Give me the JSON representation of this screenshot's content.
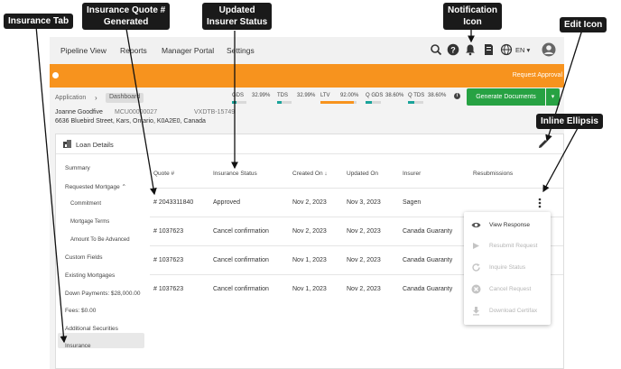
{
  "nav": {
    "items": [
      "Pipeline View",
      "Reports",
      "Manager Portal",
      "Settings"
    ],
    "language": "EN"
  },
  "banner": {
    "text": "Request Approval"
  },
  "header": {
    "breadcrumb_root": "Application",
    "breadcrumb_current": "Dashboard",
    "borrower": "Joanne Goodfive",
    "loan_id": "MCU00000027",
    "deal_id": "VXDTB-15749",
    "address": "6636 Bluebird Street, Kars, Ontario, K0A2E0, Canada",
    "ratios": [
      {
        "label": "GDS",
        "value": "32.99%",
        "fill": 0.33,
        "color": "#1aa39a"
      },
      {
        "label": "TDS",
        "value": "32.99%",
        "fill": 0.33,
        "color": "#1aa39a"
      },
      {
        "label": "LTV",
        "value": "92.00%",
        "fill": 0.92,
        "color": "#f7931e"
      },
      {
        "label": "Q GDS",
        "value": "38.60%",
        "fill": 0.39,
        "color": "#1aa39a"
      },
      {
        "label": "Q TDS",
        "value": "38.60%",
        "fill": 0.39,
        "color": "#1aa39a"
      }
    ],
    "generate_label": "Generate Documents"
  },
  "card": {
    "title": "Loan Details"
  },
  "side": {
    "items": [
      {
        "label": "Summary",
        "sub": false
      },
      {
        "label": "Requested Mortgage ⌃",
        "sub": false
      },
      {
        "label": "Commitment",
        "sub": true
      },
      {
        "label": "Mortgage Terms",
        "sub": true
      },
      {
        "label": "Amount To Be Advanced",
        "sub": true
      },
      {
        "label": "Custom Fields",
        "sub": false
      },
      {
        "label": "Existing Mortgages",
        "sub": false
      },
      {
        "label": "Down Payments: $28,000.00",
        "sub": false
      },
      {
        "label": "Fees: $0.00",
        "sub": false
      },
      {
        "label": "Additional Securities",
        "sub": false
      },
      {
        "label": "Insurance",
        "sub": false
      }
    ]
  },
  "table": {
    "headers": [
      "Quote #",
      "Insurance Status",
      "Created On ↓",
      "Updated On",
      "Insurer",
      "Resubmissions"
    ],
    "rows": [
      [
        "# 2043311840",
        "Approved",
        "Nov 2, 2023",
        "Nov 3, 2023",
        "Sagen"
      ],
      [
        "# 1037623",
        "Cancel confirmation",
        "Nov 2, 2023",
        "Nov 2, 2023",
        "Canada Guaranty"
      ],
      [
        "# 1037623",
        "Cancel confirmation",
        "Nov 1, 2023",
        "Nov 2, 2023",
        "Canada Guaranty"
      ],
      [
        "# 1037623",
        "Cancel confirmation",
        "Nov 1, 2023",
        "Nov 2, 2023",
        "Canada Guaranty"
      ]
    ]
  },
  "menu": {
    "items": [
      {
        "label": "View Response",
        "icon": "eye-icon",
        "enabled": true
      },
      {
        "label": "Resubmit Request",
        "icon": "resubmit-icon",
        "enabled": false
      },
      {
        "label": "Inquire Status",
        "icon": "refresh-icon",
        "enabled": false
      },
      {
        "label": "Cancel Request",
        "icon": "cancel-icon",
        "enabled": false
      },
      {
        "label": "Download Certifax",
        "icon": "download-icon",
        "enabled": false
      }
    ]
  },
  "annotations": {
    "insurance_tab": "Insurance Tab",
    "quote_generated": "Insurance Quote #\nGenerated",
    "insurer_status": "Updated\nInsurer Status",
    "notification_icon": "Notification\nIcon",
    "edit_icon": "Edit Icon",
    "inline_ellipsis": "Inline Ellipsis"
  }
}
